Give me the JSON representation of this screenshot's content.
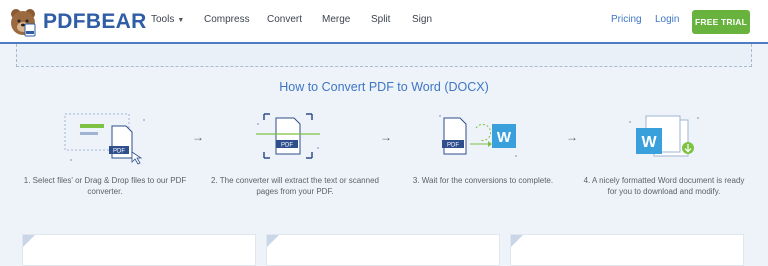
{
  "brand": {
    "name": "PDFBEAR"
  },
  "nav": {
    "tools": "Tools",
    "compress": "Compress",
    "convert": "Convert",
    "merge": "Merge",
    "split": "Split",
    "sign": "Sign",
    "pricing": "Pricing",
    "login": "Login",
    "trial": "FREE TRIAL"
  },
  "how": {
    "title": "How to Convert PDF to Word (DOCX)",
    "steps": [
      {
        "text": "1. Select files' or Drag & Drop files to our PDF converter.",
        "icon": "upload-files-icon"
      },
      {
        "text": "2. The converter will extract the text or scanned pages from your PDF.",
        "icon": "pdf-extract-icon"
      },
      {
        "text": "3. Wait for the conversions to complete.",
        "icon": "pdf-to-word-icon"
      },
      {
        "text": "4. A nicely formatted Word document is ready for you to download and modify.",
        "icon": "word-document-download-icon"
      }
    ]
  },
  "icons": {
    "pdf_label": "PDF",
    "word_label": "W"
  },
  "colors": {
    "brand_blue": "#2f5da6",
    "link_blue": "#3f76c4",
    "trial_green": "#67b33d",
    "word_blue": "#3aa0db",
    "pdf_navy": "#2f4e8c",
    "page_bg": "#eef3f9"
  }
}
